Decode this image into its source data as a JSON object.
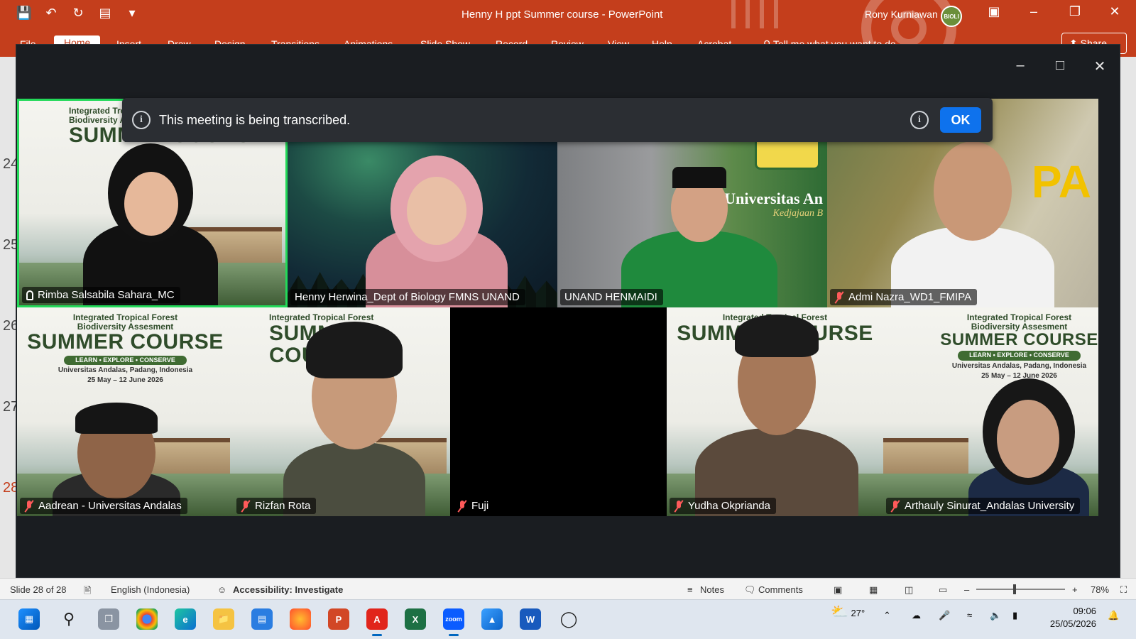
{
  "powerpoint": {
    "title": "Henny H ppt Summer course  -  PowerPoint",
    "user": "Rony Kurniawan",
    "avatar_text": "BIOLI",
    "tabs": [
      "File",
      "Home",
      "Insert",
      "Draw",
      "Design",
      "Transitions",
      "Animations",
      "Slide Show",
      "Record",
      "Review",
      "View",
      "Help",
      "Acrobat"
    ],
    "search_placeholder": "Tell me what you want to do",
    "share_label": "Share",
    "slide_numbers": [
      "24",
      "25",
      "26",
      "27",
      "28"
    ]
  },
  "zoom": {
    "banner_message": "This meeting is being transcribed.",
    "banner_ok": "OK",
    "poster": {
      "line1": "Integrated Tropical Forest",
      "line2": "Biodiversity Assesment",
      "title": "SUMMER COURSE",
      "tagline": "LEARN • EXPLORE • CONSERVE",
      "place": "Universitas Andalas, Padang, Indonesia",
      "dates": "25 May – 12 June 2026"
    },
    "campus_text_1": "Universitas An",
    "campus_text_2": "Kedjajaan B",
    "office_text": "PA",
    "participants": [
      {
        "name": "Rimba Salsabila Sahara_MC",
        "state": "pinned"
      },
      {
        "name": "Henny Herwina_Dept of Biology FMNS UNAND",
        "state": "unmuted"
      },
      {
        "name": "UNAND HENMAIDI",
        "state": "unmuted"
      },
      {
        "name": "Admi Nazra_WD1_FMIPA",
        "state": "muted"
      },
      {
        "name": "Aadrean - Universitas Andalas",
        "state": "muted"
      },
      {
        "name": "Rizfan Rota",
        "state": "muted"
      },
      {
        "name": "Fuji",
        "state": "muted"
      },
      {
        "name": "Yudha Okprianda",
        "state": "muted"
      },
      {
        "name": "Arthauly Sinurat_Andalas University",
        "state": "muted"
      }
    ]
  },
  "statusbar": {
    "slide": "Slide 28 of 28",
    "language": "English (Indonesia)",
    "accessibility": "Accessibility: Investigate",
    "notes": "Notes",
    "comments": "Comments",
    "zoom_level": "78%"
  },
  "taskbar": {
    "weather": "27°",
    "time": "09:06",
    "date": "25/05/2026",
    "zoom_app_label": "zoom"
  },
  "colors": {
    "ppt_accent": "#c43e1c",
    "zoom_ok": "#0e72ed",
    "active_speaker": "#23d959",
    "muted": "#ff5a5a"
  }
}
